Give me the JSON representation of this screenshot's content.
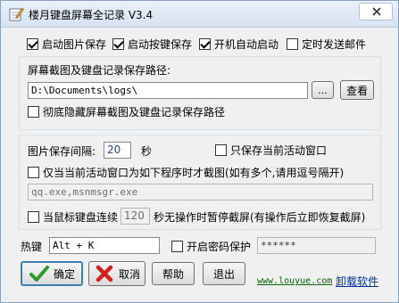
{
  "window": {
    "title": "楼月键盘屏幕全记录 V3.4"
  },
  "options_top": [
    {
      "label": "启动图片保存",
      "checked": true
    },
    {
      "label": "启动按键保存",
      "checked": true
    },
    {
      "label": "开机自动启动",
      "checked": true
    },
    {
      "label": "定时发送邮件",
      "checked": false
    }
  ],
  "path_group": {
    "label": "屏幕截图及键盘记录保存路径:",
    "path_value": "D:\\Documents\\logs\\",
    "browse_label": "...",
    "view_label": "查看",
    "hide_path_label": "彻底隐藏屏幕截图及键盘记录保存路径",
    "hide_path_checked": false
  },
  "capture_group": {
    "interval_label": "图片保存间隔:",
    "interval_value": "20",
    "interval_unit": "秒",
    "active_only_label": "只保存当前活动窗口",
    "active_only_checked": false,
    "program_only_label": "仅当当前活动窗口为如下程序时才截图(如有多个,请用逗号隔开)",
    "program_only_checked": false,
    "program_list": "qq.exe,msnmsgr.exe",
    "pause_label": "当鼠标键盘连续",
    "pause_value": "120",
    "pause_suffix": "秒无操作时暂停截屏(有操作后立即恢复截屏)",
    "pause_checked": false
  },
  "hotkey": {
    "label": "热键",
    "value": "Alt + K",
    "password_label": "开启密码保护",
    "password_checked": false,
    "password_value": "******"
  },
  "buttons": {
    "ok": "确定",
    "cancel": "取消",
    "help": "帮助",
    "exit": "退出"
  },
  "footer": {
    "website": "www.louyue.com",
    "uninstall": "卸载软件"
  },
  "colors": {
    "accent": "#3c7fb1",
    "link_green": "#006600",
    "link_blue": "#003399"
  }
}
